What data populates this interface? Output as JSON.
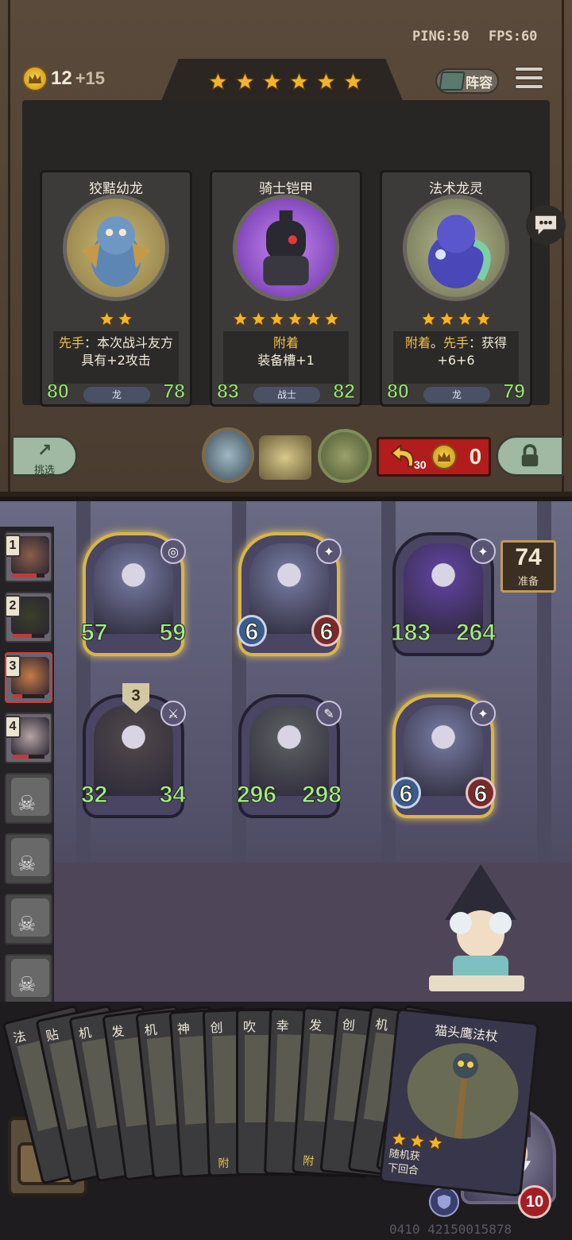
{
  "status": {
    "ping": "PING:50",
    "fps": "FPS:60"
  },
  "gold": {
    "value": "12",
    "income": "+15"
  },
  "tavern_tier": 6,
  "lineup_label": "阵容",
  "shop": {
    "cards": [
      {
        "name": "狡黠幼龙",
        "tier": 2,
        "desc": [
          [
            "kw",
            "先手"
          ],
          [
            "t",
            "：本次战斗友方"
          ],
          [
            "br",
            ""
          ],
          [
            "t",
            "具有+2攻击"
          ]
        ],
        "attack": "80",
        "health": "78",
        "race": "龙"
      },
      {
        "name": "骑士铠甲",
        "tier": 6,
        "desc": [
          [
            "kw",
            "附着"
          ],
          [
            "br",
            ""
          ],
          [
            "t",
            "装备槽+1"
          ]
        ],
        "attack": "83",
        "health": "82",
        "race": "战士"
      },
      {
        "name": "法术龙灵",
        "tier": 4,
        "desc": [
          [
            "kw",
            "附着"
          ],
          [
            "t",
            "。"
          ],
          [
            "kw",
            "先手"
          ],
          [
            "t",
            "：获得"
          ],
          [
            "br",
            ""
          ],
          [
            "t",
            "+6+6"
          ]
        ],
        "attack": "80",
        "health": "79",
        "race": "龙"
      }
    ]
  },
  "controls": {
    "refresh_label": "挑选",
    "upgrade_cost": "30",
    "upgrade_gold": "0"
  },
  "leaderboard": [
    {
      "rank": "1",
      "alive": true,
      "hp": 0.75,
      "color": "#8a5e4a"
    },
    {
      "rank": "2",
      "alive": true,
      "hp": 0.6,
      "color": "#3a3f2a"
    },
    {
      "rank": "3",
      "alive": true,
      "hp": 0.3,
      "color": "#c77a48"
    },
    {
      "rank": "4",
      "alive": true,
      "hp": 0.5,
      "color": "#b6a4a6"
    },
    {
      "rank": "",
      "alive": false
    },
    {
      "rank": "",
      "alive": false
    },
    {
      "rank": "",
      "alive": false
    },
    {
      "rank": "",
      "alive": false
    }
  ],
  "board": {
    "minions": [
      {
        "attack": "57",
        "health": "59",
        "golden": true,
        "badge": false,
        "art": "#6c6f93",
        "tag": "spiral-icon"
      },
      {
        "attack": "6",
        "health": "6",
        "golden": true,
        "badge": true,
        "art": "#6c6f93",
        "tag": "star-icon"
      },
      {
        "attack": "183",
        "health": "264",
        "golden": false,
        "badge": false,
        "art": "#5a3f93",
        "tag": "star-icon"
      },
      {
        "attack": "32",
        "health": "34",
        "golden": false,
        "badge": false,
        "art": "#4a4448",
        "tag": "sword-icon",
        "shield": "3"
      },
      {
        "attack": "296",
        "health": "298",
        "golden": false,
        "badge": false,
        "art": "#55585c",
        "tag": "wrench-icon"
      },
      {
        "attack": "6",
        "health": "6",
        "golden": true,
        "badge": true,
        "art": "#6c6f93",
        "tag": "star-icon"
      }
    ]
  },
  "timer": {
    "value": "74",
    "label": "准备"
  },
  "hand": {
    "cards": [
      {
        "title": "法",
        "keyword": ""
      },
      {
        "title": "贴",
        "keyword": ""
      },
      {
        "title": "机",
        "keyword": ""
      },
      {
        "title": "发",
        "keyword": ""
      },
      {
        "title": "机",
        "keyword": ""
      },
      {
        "title": "神",
        "keyword": ""
      },
      {
        "title": "创",
        "keyword": "附"
      },
      {
        "title": "吹",
        "keyword": ""
      },
      {
        "title": "幸",
        "keyword": ""
      },
      {
        "title": "发",
        "keyword": "附"
      },
      {
        "title": "创",
        "keyword": ""
      },
      {
        "title": "机",
        "keyword": ""
      },
      {
        "title": "机",
        "keyword": ""
      }
    ],
    "featured": {
      "title": "猫头鹰法杖",
      "tier": 3,
      "desc_lines": [
        "随机获",
        "下回合"
      ]
    }
  },
  "hero": {
    "health": "10"
  },
  "footer_code": "0410 42150015878"
}
